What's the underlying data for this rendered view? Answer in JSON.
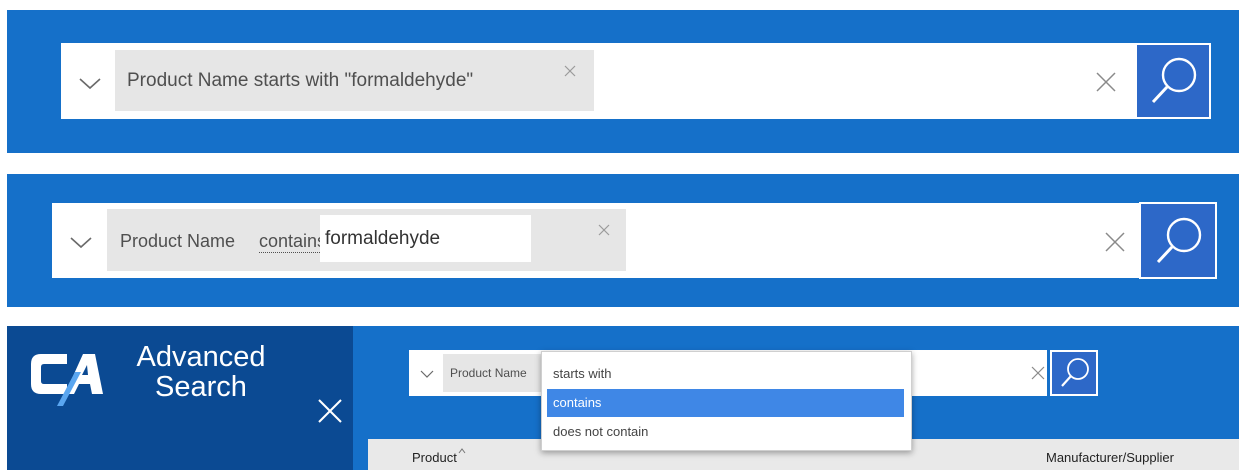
{
  "panel1": {
    "filter_text": "Product Name starts with \"formaldehyde\"",
    "remove_icon": "close-icon",
    "clear_icon": "close-icon",
    "search_icon": "search-icon",
    "toggle_icon": "chevron-down-icon"
  },
  "panel2": {
    "field_label": "Product Name",
    "operator_label": "contains",
    "value": "formaldehyde",
    "remove_icon": "close-icon",
    "clear_icon": "close-icon",
    "search_icon": "search-icon",
    "toggle_icon": "chevron-down-icon"
  },
  "panel3": {
    "brand": {
      "logo": "CA",
      "title_line1": "Advanced",
      "title_line2": "Search",
      "close_icon": "close-icon"
    },
    "field_label": "Product Name",
    "operator_options": [
      "starts with",
      "contains",
      "does not contain"
    ],
    "selected_operator": "contains",
    "table_headers": {
      "product": "Product",
      "manufacturer": "Manufacturer/Supplier"
    }
  },
  "colors": {
    "panel_blue": "#1570c9",
    "brand_navy": "#0b4a93",
    "button_blue": "#2d68c8",
    "chip_gray": "#e6e6e6",
    "option_highlight": "#3f87e6"
  }
}
